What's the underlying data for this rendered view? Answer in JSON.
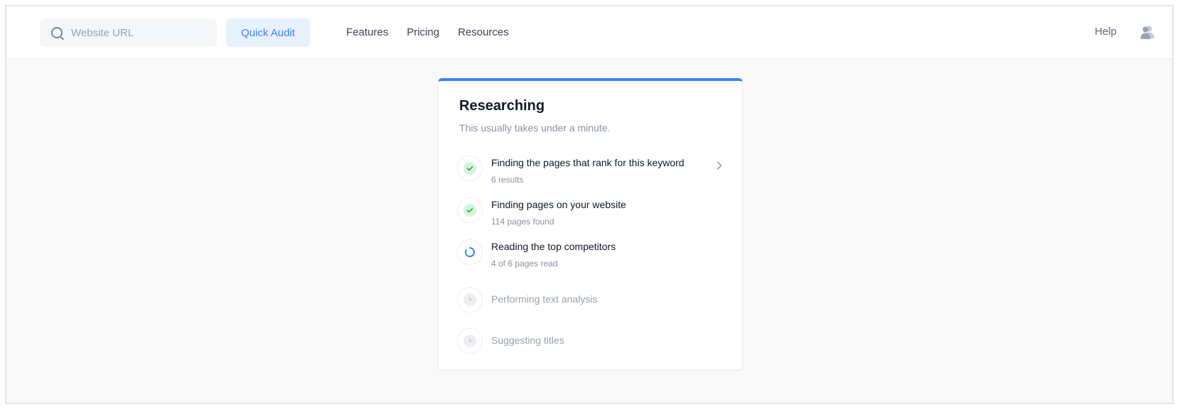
{
  "header": {
    "search": {
      "placeholder": "Website URL",
      "value": ""
    },
    "quick_audit_label": "Quick Audit",
    "nav": [
      "Features",
      "Pricing",
      "Resources"
    ],
    "help_label": "Help",
    "avatar_icon": "users-icon"
  },
  "card": {
    "title": "Researching",
    "subtitle": "This usually takes under a minute.",
    "accent_color": "#3b82f6",
    "steps": [
      {
        "title": "Finding the pages that rank for this keyword",
        "detail": "6 results",
        "status": "done",
        "icon": "check-icon",
        "expandable": true
      },
      {
        "title": "Finding pages on your website",
        "detail": "114 pages found",
        "status": "done",
        "icon": "check-icon"
      },
      {
        "title": "Reading the top competitors",
        "detail": "4 of 6 pages read",
        "status": "in-progress",
        "icon": "spinner-icon"
      },
      {
        "title": "Performing text analysis",
        "detail": "",
        "status": "pending",
        "icon": "clock-icon"
      },
      {
        "title": "Suggesting titles",
        "detail": "",
        "status": "pending",
        "icon": "clock-icon"
      }
    ]
  }
}
